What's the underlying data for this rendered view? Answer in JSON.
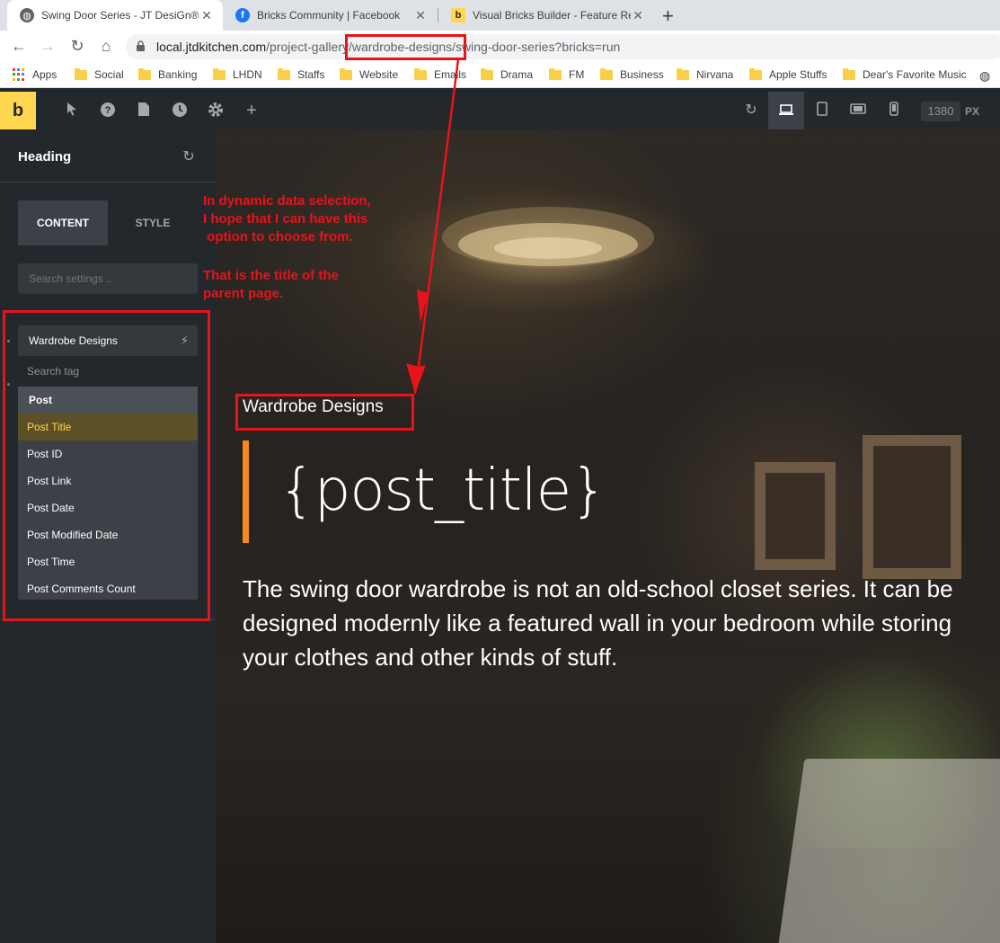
{
  "browser": {
    "tabs": [
      {
        "title": "Swing Door Series - JT DesiGn®",
        "close": "✕"
      },
      {
        "title": "Bricks Community | Facebook",
        "close": "✕"
      },
      {
        "title": "Visual Bricks Builder - Feature Re",
        "close": "✕"
      }
    ],
    "new_tab": "+",
    "url": {
      "host": "local.jtdkitchen.com",
      "path": "/project-gallery/wardrobe-designs/swing-door-series?bricks=run"
    },
    "bookmarks": [
      "Apps",
      "Social",
      "Banking",
      "LHDN",
      "Staffs",
      "Website",
      "Emails",
      "Drama",
      "FM",
      "Business",
      "Nirvana",
      "Apple Stuffs",
      "Dear's Favorite Music"
    ]
  },
  "toolbar": {
    "logo": "b",
    "width_value": "1380",
    "width_unit": "PX"
  },
  "panel": {
    "title": "Heading",
    "tabs": {
      "content": "CONTENT",
      "style": "STYLE"
    },
    "search_placeholder": "Search settings ..",
    "field_value": "Wardrobe Designs",
    "dropdown": {
      "search_placeholder": "Search tag",
      "group": "Post",
      "items": [
        "Post Title",
        "Post ID",
        "Post Link",
        "Post Date",
        "Post Modified Date",
        "Post Time",
        "Post Comments Count"
      ],
      "selected_index": 0
    }
  },
  "canvas": {
    "heading": "Wardrobe Designs",
    "post_title": "{post_title}",
    "description": "The swing door wardrobe is not an old-school closet series. It can be designed modernly like a featured wall in your bedroom while storing your clothes and other kinds of stuff."
  },
  "annotations": {
    "note1": "In dynamic data selection, I hope that I can have this option to choose from.",
    "note1_lines": [
      "In dynamic data selection,",
      "I hope that I can have this",
      " option to choose from."
    ],
    "note2_lines": [
      "That is the title of the",
      "parent page."
    ]
  },
  "colors": {
    "accent_yellow": "#ffd64f",
    "accent_orange": "#f58a1f",
    "annotation_red": "#e8131b",
    "sidebar_bg": "#23282d"
  }
}
